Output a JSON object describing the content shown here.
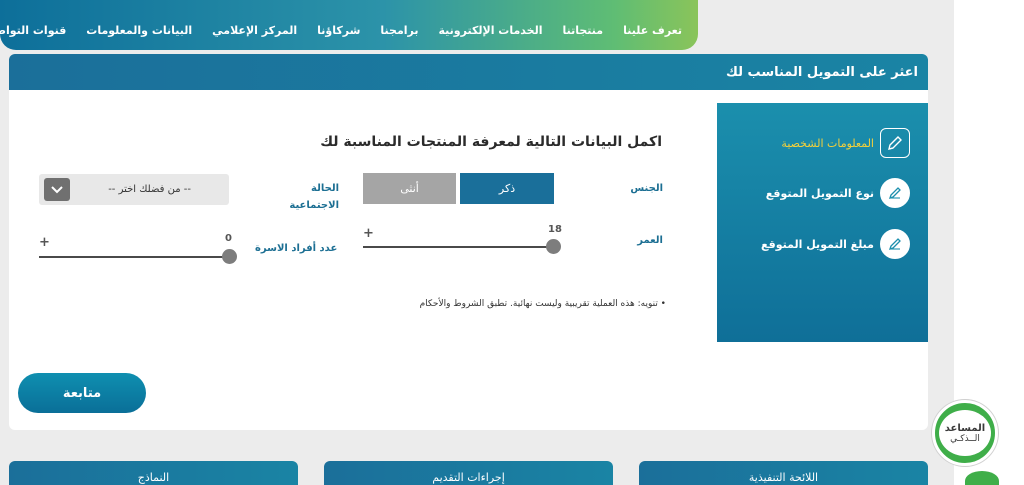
{
  "nav": {
    "items": [
      "تعرف علينا",
      "منتجاتنا",
      "الخدمات الإلكترونية",
      "برامجنا",
      "شركاؤنا",
      "المركز الإعلامي",
      "البيانات والمعلومات",
      "قنوات التواصل"
    ]
  },
  "card": {
    "title": "اعثر على التمويل المناسب لك"
  },
  "steps": [
    {
      "label": "المعلومات الشخصية",
      "icon": "edit-square-icon",
      "active": true
    },
    {
      "label": "نوع التمويل المتوقع",
      "icon": "edit-circle-icon",
      "active": false
    },
    {
      "label": "مبلغ التمويل المتوقع",
      "icon": "edit-circle-icon",
      "active": false
    }
  ],
  "form": {
    "title": "اكمل البيانات التالية لمعرفة المنتجات المناسبة لك",
    "gender_label": "الجنس",
    "gender_options": [
      "ذكر",
      "أنثى"
    ],
    "gender_selected": "ذكر",
    "marital_label_line1": "الحالة",
    "marital_label_line2": "الاجتماعية",
    "marital_placeholder": "-- من فضلك اختر --",
    "age_label": "العمر",
    "age_value": "18",
    "family_label": "عدد أفراد الاسرة",
    "family_value": "0",
    "plus_sign": "+",
    "note": "• تنويه: هذه العملية تقريبية وليست نهائية. تطبق الشروط والأحكام",
    "next_label": "متابعة"
  },
  "bottom_tabs": [
    "اللائحة التنفيذية",
    "إجراءات التقديم",
    "النماذج"
  ],
  "assistant": {
    "line1": "المساعد",
    "line2": "الــذكـي"
  },
  "colors": {
    "primary": "#1b6f9a",
    "accent_yellow": "#f6d13a",
    "assistant_green": "#3fae49"
  }
}
